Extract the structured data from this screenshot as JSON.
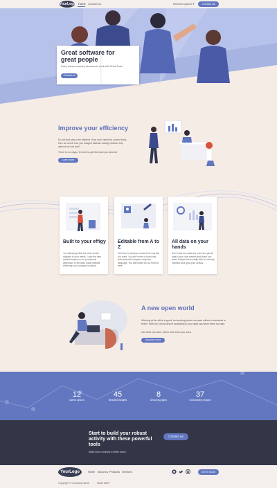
{
  "nav": {
    "logo": "YourLogo",
    "links": [
      "Home",
      "Contact us"
    ],
    "lang": "Internal system ▾",
    "cta": "Contact us"
  },
  "hero": {
    "title": "Great software for great people",
    "subtitle": "Every dream company deserves to work with Great Tools.",
    "button": "Contact us"
  },
  "efficiency": {
    "title": "Improve your efficiency",
    "p1": "Do not find way to be efficient. If we don't need the correct tools, then we need! Can you imagine Batman saving Gotham City without his tool belt?",
    "p2": "There is no magic, it's time to get the tools you deserve.",
    "button": "Learn more"
  },
  "cards": [
    {
      "title": "Built to your effigy",
      "text": "You will accept that the clear choice adapted to your needs. I saw the best website based on our provisional dimension to the tailor made website reflecting your company's values."
    },
    {
      "title": "Editable from A to Z",
      "text": "Feel free to edit your content the way like you want. You don't need to know any technical skill compare computer language. You will helped by our team to here."
    },
    {
      "title": "All data on your hands",
      "text": "Don't miss any data any more and get all data in your own system and share you want. Analyse them easily with our friendly interface and grow your activity."
    }
  ],
  "world": {
    "title": "A new open world",
    "p1": "Working at the office is good, but working where we want without constraints is better. With our Cloud service accessing to your data has never been so easy.",
    "p2": "Get what you want, where and when you want.",
    "button": "Discover more"
  },
  "stats": [
    {
      "value": "12",
      "label": "Useful options"
    },
    {
      "value": "45",
      "label": "Beautiful widgets"
    },
    {
      "value": "8",
      "label": "Amazing pages"
    },
    {
      "value": "37",
      "label": "Outstanding images"
    }
  ],
  "cta": {
    "title": "Start to build your robust activity with these powerful tools",
    "subtitle": "Make your company a better place.",
    "button": "Contact us"
  },
  "footer": {
    "logo": "YourLogo",
    "links": [
      "Home",
      "About us",
      "Products",
      "Services"
    ],
    "copyright": "Copyright © Company Name",
    "made": "Made with",
    "cta": "Get in touch"
  },
  "colors": {
    "accent": "#6277c0",
    "dark": "#333646",
    "bg": "#f6ece6"
  }
}
